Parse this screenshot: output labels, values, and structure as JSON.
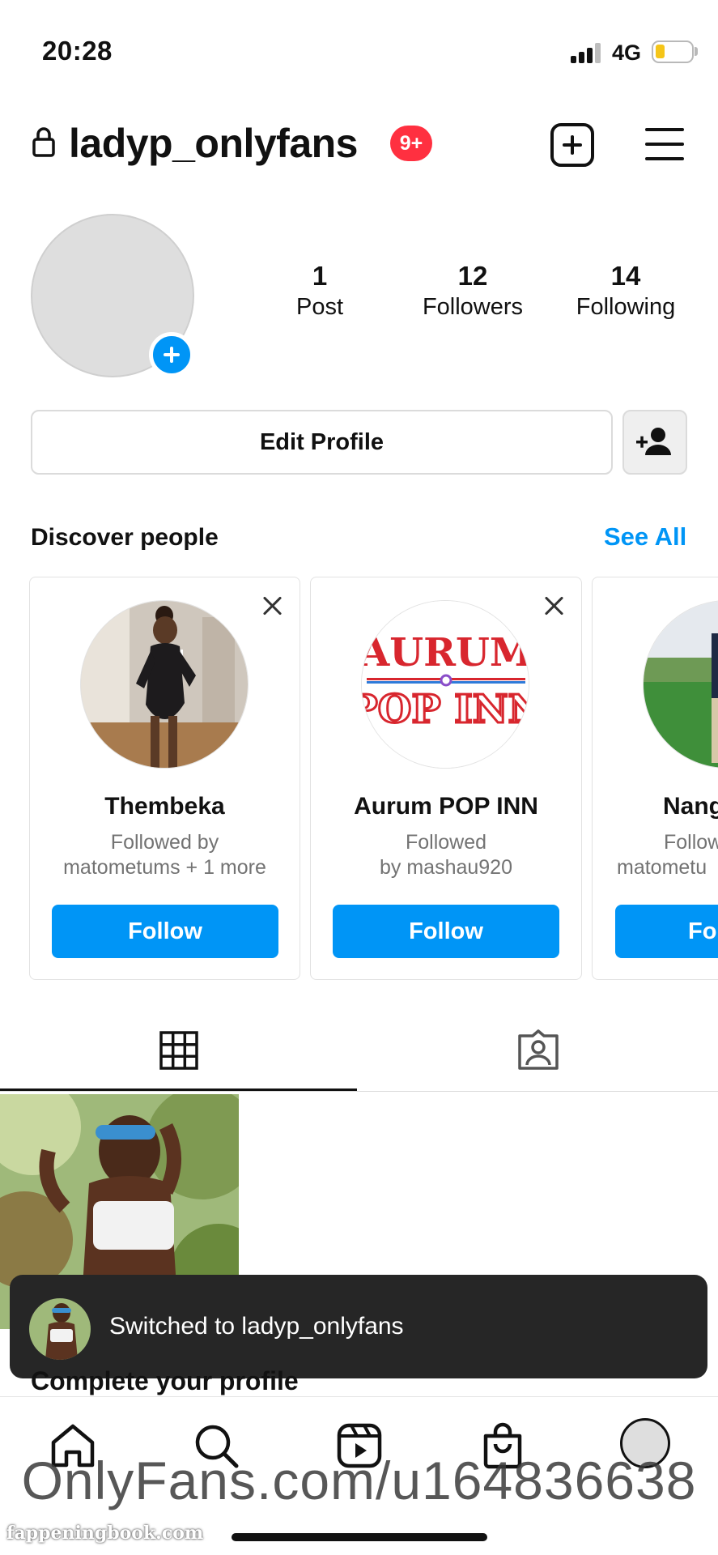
{
  "status_bar": {
    "time": "20:28",
    "network": "4G",
    "battery_level": 0.2
  },
  "header": {
    "username": "ladyp_onlyfans",
    "notification_badge": "9+"
  },
  "profile": {
    "stats": [
      {
        "value": "1",
        "label": "Post"
      },
      {
        "value": "12",
        "label": "Followers"
      },
      {
        "value": "14",
        "label": "Following"
      }
    ],
    "edit_profile_label": "Edit Profile"
  },
  "discover": {
    "title": "Discover people",
    "see_all": "See All",
    "cards": [
      {
        "name": "Thembeka",
        "subtitle_line1": "Followed by",
        "subtitle_line2": "matometums + 1 more",
        "button": "Follow"
      },
      {
        "name": "Aurum POP INN",
        "subtitle_line1": "Followed",
        "subtitle_line2": "by mashau920",
        "button": "Follow",
        "logo_line1": "AURUM",
        "logo_line2": "POP INN"
      },
      {
        "name": "Nang",
        "subtitle_line1": "Follow",
        "subtitle_line2": "matometu",
        "button": "Fo"
      }
    ]
  },
  "toast": {
    "message": "Switched to ladyp_onlyfans"
  },
  "complete_profile": {
    "title": "Complete your profile"
  },
  "watermark": {
    "text": "OnlyFans.com/u164836638",
    "site": "fappeningbook.com"
  },
  "colors": {
    "accent": "#0095f6",
    "badge": "#ff3040",
    "toast_bg": "#262626"
  },
  "icons": {
    "nav": [
      "home-icon",
      "search-icon",
      "reels-icon",
      "shop-icon",
      "profile-avatar"
    ],
    "tabs": [
      "grid-icon",
      "tagged-icon"
    ]
  }
}
